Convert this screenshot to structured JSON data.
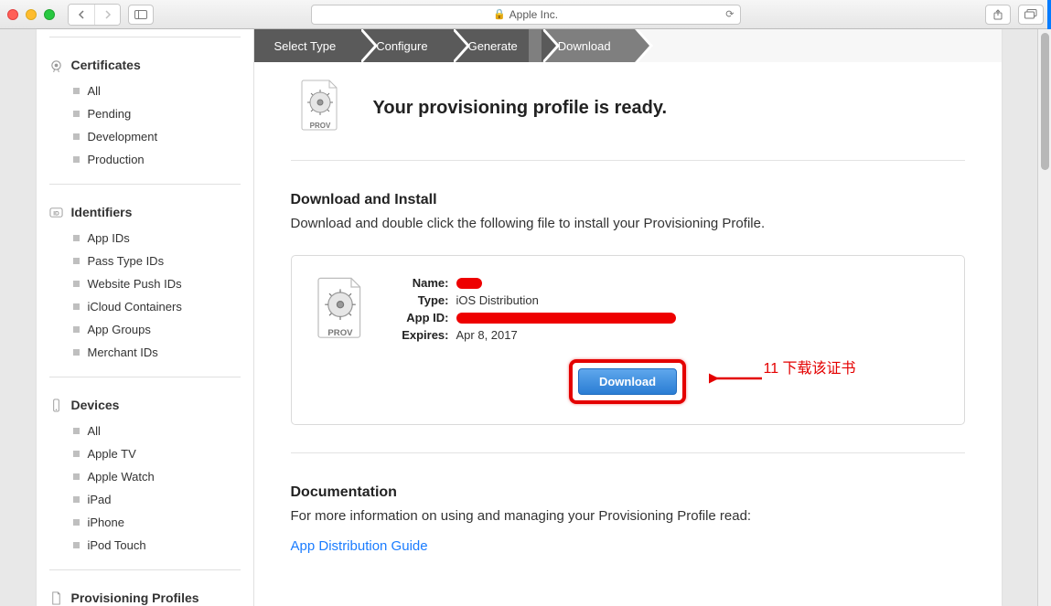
{
  "window": {
    "site": "Apple Inc."
  },
  "sidebar": {
    "certificates": {
      "title": "Certificates",
      "items": [
        "All",
        "Pending",
        "Development",
        "Production"
      ]
    },
    "identifiers": {
      "title": "Identifiers",
      "items": [
        "App IDs",
        "Pass Type IDs",
        "Website Push IDs",
        "iCloud Containers",
        "App Groups",
        "Merchant IDs"
      ]
    },
    "devices": {
      "title": "Devices",
      "items": [
        "All",
        "Apple TV",
        "Apple Watch",
        "iPad",
        "iPhone",
        "iPod Touch"
      ]
    },
    "profiles": {
      "title": "Provisioning Profiles"
    }
  },
  "steps": {
    "s1": "Select Type",
    "s2": "Configure",
    "s3": "Generate",
    "s4": "Download"
  },
  "main": {
    "ready_title": "Your provisioning profile is ready.",
    "download_title": "Download and Install",
    "download_body": "Download and double click the following file to install your Provisioning Profile.",
    "name_label": "Name:",
    "type_label": "Type:",
    "type_value": "iOS Distribution",
    "appid_label": "App ID:",
    "expires_label": "Expires:",
    "expires_value": "Apr 8, 2017",
    "download_btn": "Download",
    "annotation": "11 下载该证书",
    "doc_title": "Documentation",
    "doc_body": "For more information on using and managing your Provisioning Profile read:",
    "doc_link": "App Distribution Guide"
  }
}
